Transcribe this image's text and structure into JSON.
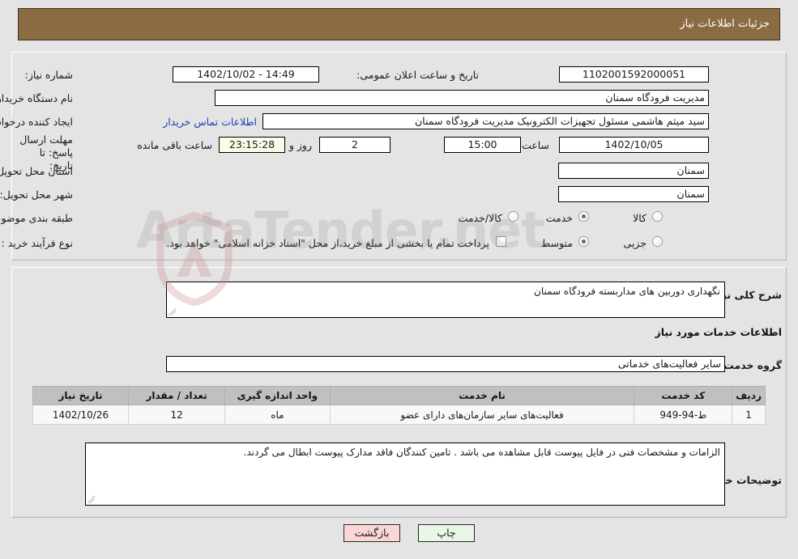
{
  "header": {
    "title": "جزئیات اطلاعات نیاز"
  },
  "top_form": {
    "labels": {
      "need_number": "شماره نیاز:",
      "announce_datetime": "تاریخ و ساعت اعلان عمومی:",
      "buyer_org": "نام دستگاه خریدار:",
      "request_creator": "ایجاد کننده درخواست:",
      "response_deadline": "مهلت ارسال پاسخ: تا تاریخ:",
      "hour": "ساعت",
      "day_and": "روز و",
      "remaining": "ساعت باقی مانده",
      "delivery_province": "استان محل تحویل:",
      "delivery_city": "شهر محل تحویل:",
      "subject_class": "طبقه بندی موضوعی:",
      "purchase_type": "نوع فرآیند خرید :"
    },
    "values": {
      "need_number": "1102001592000051",
      "announce_datetime": "1402/10/02 - 14:49",
      "buyer_org": "مدیریت فرودگاه سمنان",
      "request_creator": "سید میثم هاشمی مسئول تجهیزات الکترونیک مدیریت فرودگاه سمنان",
      "deadline_date": "1402/10/05",
      "deadline_hour": "15:00",
      "remaining_days": "2",
      "remaining_clock": "23:15:28",
      "delivery_province": "سمنان",
      "delivery_city": "سمنان"
    },
    "contact_link": "اطلاعات تماس خریدار",
    "subject_class_options": [
      {
        "label": "کالا",
        "selected": false
      },
      {
        "label": "خدمت",
        "selected": true
      },
      {
        "label": "کالا/خدمت",
        "selected": false
      }
    ],
    "purchase_type_options": [
      {
        "label": "جزیی",
        "selected": false
      },
      {
        "label": "متوسط",
        "selected": true
      }
    ],
    "treasury_checkbox": {
      "checked": false,
      "label": "پرداخت تمام یا بخشی از مبلغ خرید،از محل \"اسناد خزانه اسلامی\" خواهد بود."
    }
  },
  "bottom": {
    "general_desc_label": "شرح کلی نیاز:",
    "general_desc_value": "نگهداری دوربین های مداربسته فرودگاه سمنان",
    "services_heading": "اطلاعات خدمات مورد نیاز",
    "service_group_label": "گروه خدمت:",
    "service_group_value": "سایر فعالیت‌های خدماتی",
    "buyer_notes_label": "توضیحات خریدار:",
    "buyer_notes_value": "الزامات و مشخصات فنی در فایل پیوست قابل مشاهده می باشد . تامین کنندگان فاقد مدارک پیوست ابطال می گردند."
  },
  "table": {
    "columns": [
      "ردیف",
      "کد خدمت",
      "نام خدمت",
      "واحد اندازه گیری",
      "تعداد / مقدار",
      "تاریخ نیاز"
    ],
    "rows": [
      {
        "row_no": "1",
        "service_code": "ط-94-949",
        "service_name": "فعالیت‌های سایر سازمان‌های دارای عضو",
        "unit": "ماه",
        "quantity": "12",
        "need_date": "1402/10/26"
      }
    ]
  },
  "footer": {
    "print_label": "چاپ",
    "back_label": "بازگشت"
  },
  "watermark": {
    "text": "ArtaTender.net"
  },
  "colors": {
    "header_bg": "#8b6b42",
    "page_bg": "#e4e4e4",
    "link": "#1b3fb8",
    "table_header_bg": "#c0c0c0",
    "print_btn_bg": "#e8f7e6",
    "back_btn_bg": "#fad6d6",
    "countdown_bg": "#fbfbe8"
  }
}
